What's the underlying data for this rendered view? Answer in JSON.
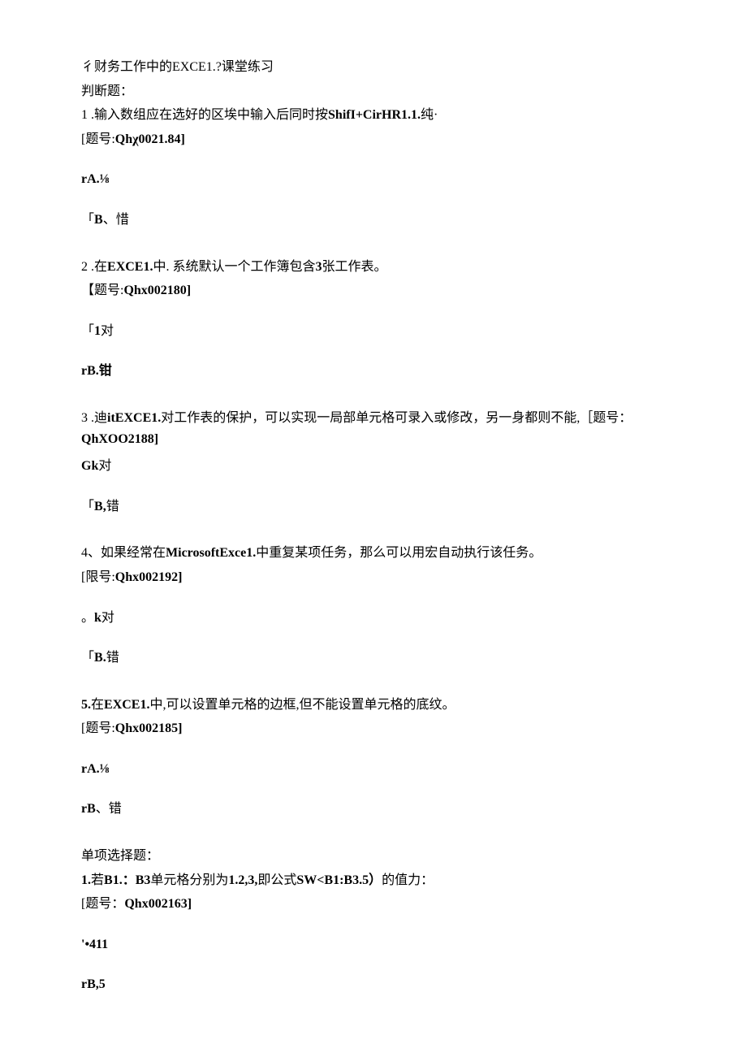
{
  "title": "彳财务工作中的EXCE1.?课堂练习",
  "section1_header": "判断题：",
  "q1": {
    "text_prefix": "1   .输入数组应在选好的区埃中输入后同时按",
    "text_bold": "ShifI+CirHR1.1.",
    "text_suffix": "纯·",
    "id_prefix": "[题号:",
    "id_bold": "Qhχ0021.84]",
    "optA": "rA.⅛",
    "optB_prefix": "「",
    "optB_bold": "B",
    "optB_suffix": "、惜"
  },
  "q2": {
    "text_prefix": "2   .在",
    "text_bold1": "EXCE1.",
    "text_mid": "中. 系统默认一个工作簿包含",
    "text_bold2": "3",
    "text_suffix": "张工作表。",
    "id_prefix": "【题号:",
    "id_bold": "Qhx002180]",
    "optA_prefix": "「",
    "optA_bold": "1",
    "optA_suffix": "对",
    "optB": "rB.钳"
  },
  "q3": {
    "text_prefix": "3   .迪",
    "text_bold": "itEXCE1.",
    "text_suffix": "对工作表的保护，可以实现一局部单元格可录入或修改，另一身都则不能,［题号：",
    "id_bold": "QhXOO2188]",
    "optA_bold": "Gk",
    "optA_suffix": "对",
    "optB_prefix": "「",
    "optB_bold": "B,",
    "optB_suffix": "错"
  },
  "q4": {
    "text_prefix": "4、如果经常在",
    "text_bold": "MicrosoftExce1.",
    "text_suffix": "中重复某项任务，那么可以用宏自动执行该任务。",
    "id_prefix": "[限号:",
    "id_bold": "Qhx002192]",
    "optA_prefix": "。",
    "optA_bold": "k",
    "optA_suffix": "对",
    "optB_prefix": "「",
    "optB_bold": "B.",
    "optB_suffix": "错"
  },
  "q5": {
    "text_prefix": "5.",
    "text_after": "在",
    "text_bold": "EXCE1.",
    "text_suffix": "中,可以设置单元格的边框,但不能设置单元格的底纹。",
    "id_prefix": "[题号:",
    "id_bold": "Qhx002185]",
    "optA": "rA.⅛",
    "optB_prefix": "r",
    "optB_bold": "B",
    "optB_suffix": "、错"
  },
  "section2_header": "单项选择题：",
  "mc1": {
    "text_prefix": "1.",
    "text_after": "若",
    "text_bold1": "B1.：B3",
    "text_mid1": "单元格分别为",
    "text_bold2": "1.2,3,",
    "text_mid2": "即公式",
    "text_bold3": "SW<B1:B3.5）",
    "text_suffix": "的值力：",
    "id_prefix": "[题号：",
    "id_bold": "Qhx002163]",
    "optA": "'•411",
    "optB": "rB,5"
  }
}
